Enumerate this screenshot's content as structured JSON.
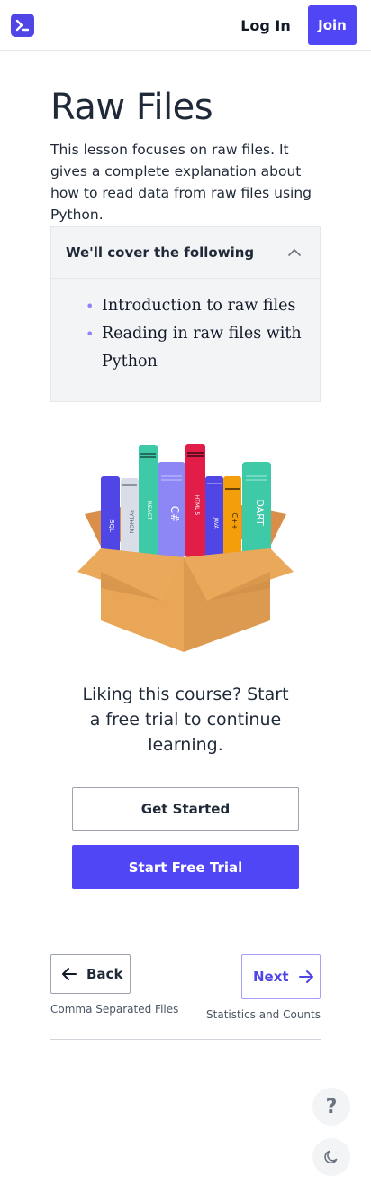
{
  "header": {
    "logo_icon": "terminal-prompt-icon",
    "login_label": "Log In",
    "join_label": "Join",
    "accent_color": "#5046f6"
  },
  "lesson": {
    "title": "Raw Files",
    "summary": "This lesson focuses on raw files. It gives a complete explanation about how to read data from raw files using Python."
  },
  "cover": {
    "heading": "We'll cover the following",
    "items": [
      "Introduction to raw files",
      "Reading in raw files with Python"
    ]
  },
  "illustration": {
    "book_labels": [
      "SQL",
      "PYTHON",
      "REACT",
      "C#",
      "HTML 5",
      "JAVA",
      "C++",
      "DART"
    ]
  },
  "promo": {
    "text": "Liking this course? Start a free trial to continue learning.",
    "get_started_label": "Get Started",
    "trial_label": "Start Free Trial"
  },
  "navigation": {
    "back_label": "Back",
    "back_caption": "Comma Separated Files",
    "next_label": "Next",
    "next_caption": "Statistics and Counts"
  },
  "floating": {
    "help_label": "?",
    "theme_icon": "moon-icon"
  }
}
